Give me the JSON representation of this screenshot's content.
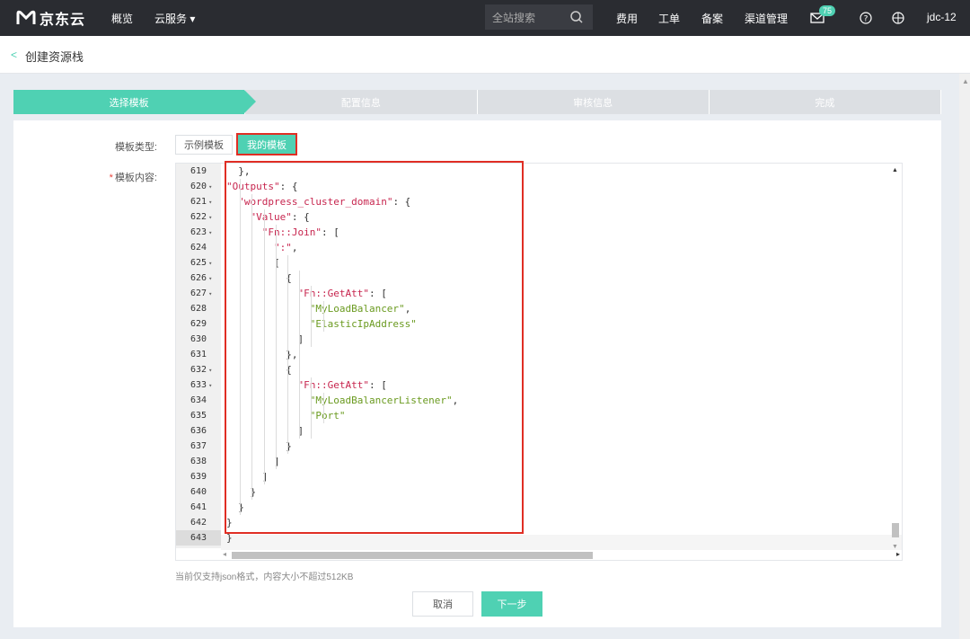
{
  "topbar": {
    "brand": "京东云",
    "nav_overview": "概览",
    "nav_cloud": "云服务 ▾",
    "search_placeholder": "全站搜索",
    "links": [
      "费用",
      "工单",
      "备案",
      "渠道管理"
    ],
    "badge": "75",
    "user": "jdc-12"
  },
  "page": {
    "back": "<",
    "title": "创建资源栈"
  },
  "steps": [
    "选择模板",
    "配置信息",
    "审核信息",
    "完成"
  ],
  "form": {
    "type_label": "模板类型:",
    "type_options": [
      "示例模板",
      "我的模板"
    ],
    "content_required": "*",
    "content_label": "模板内容:",
    "hint": "当前仅支持json格式，内容大小不超过512KB"
  },
  "editor": {
    "lines": [
      {
        "n": "619",
        "f": false,
        "t": "  },"
      },
      {
        "n": "620",
        "f": true,
        "t": "\"Outputs\": {"
      },
      {
        "n": "621",
        "f": true,
        "t": "  \"wordpress_cluster_domain\": {"
      },
      {
        "n": "622",
        "f": true,
        "t": "    \"Value\": {"
      },
      {
        "n": "623",
        "f": true,
        "t": "      \"Fn::Join\": ["
      },
      {
        "n": "624",
        "f": false,
        "t": "        \":\","
      },
      {
        "n": "625",
        "f": true,
        "t": "        ["
      },
      {
        "n": "626",
        "f": true,
        "t": "          {"
      },
      {
        "n": "627",
        "f": true,
        "t": "            \"Fn::GetAtt\": ["
      },
      {
        "n": "628",
        "f": false,
        "t": "              \"MyLoadBalancer\","
      },
      {
        "n": "629",
        "f": false,
        "t": "              \"ElasticIpAddress\""
      },
      {
        "n": "630",
        "f": false,
        "t": "            ]"
      },
      {
        "n": "631",
        "f": false,
        "t": "          },"
      },
      {
        "n": "632",
        "f": true,
        "t": "          {"
      },
      {
        "n": "633",
        "f": true,
        "t": "            \"Fn::GetAtt\": ["
      },
      {
        "n": "634",
        "f": false,
        "t": "              \"MyLoadBalancerListener\","
      },
      {
        "n": "635",
        "f": false,
        "t": "              \"Port\""
      },
      {
        "n": "636",
        "f": false,
        "t": "            ]"
      },
      {
        "n": "637",
        "f": false,
        "t": "          }"
      },
      {
        "n": "638",
        "f": false,
        "t": "        ]"
      },
      {
        "n": "639",
        "f": false,
        "t": "      ]"
      },
      {
        "n": "640",
        "f": false,
        "t": "    }"
      },
      {
        "n": "641",
        "f": false,
        "t": "  }"
      },
      {
        "n": "642",
        "f": false,
        "t": "}"
      },
      {
        "n": "643",
        "f": false,
        "t": "}"
      }
    ]
  },
  "buttons": {
    "cancel": "取消",
    "next": "下一步"
  },
  "colors": {
    "accent": "#4fd1b3",
    "topbar": "#2a2c31",
    "highlight": "#e02e24"
  },
  "icons": [
    "logo-icon",
    "search-icon",
    "mail-icon",
    "help-icon",
    "globe-icon",
    "chevron-left-icon"
  ]
}
